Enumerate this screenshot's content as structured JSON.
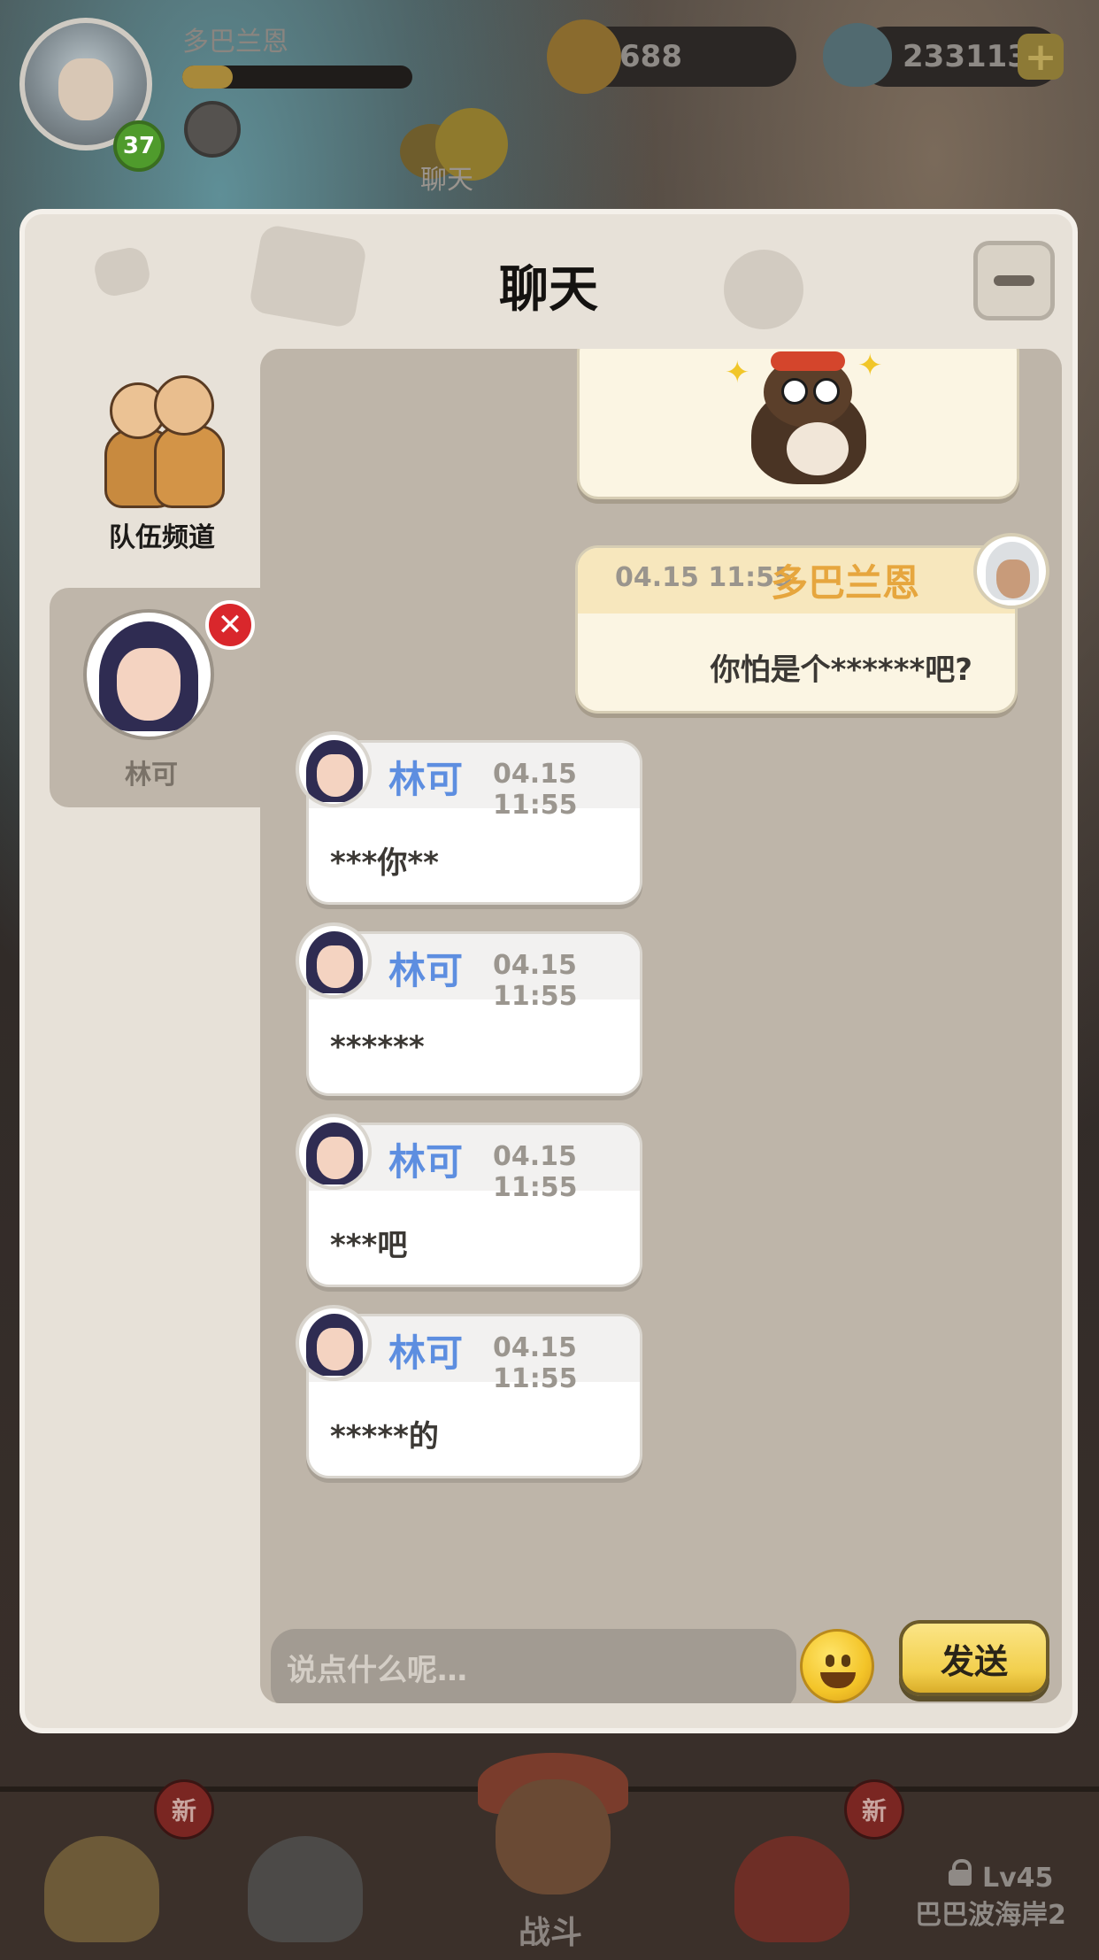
{
  "topbar": {
    "player_name": "多巴兰恩",
    "level": "37",
    "xp_progress": 0.22,
    "gold": "688",
    "gems": "233113",
    "plus_label": "+",
    "chat_label": "聊天"
  },
  "chat": {
    "title": "聊天",
    "channels": {
      "team_label": "队伍频道",
      "contact_name": "林可",
      "close_glyph": "✕"
    },
    "my_message": {
      "time": "04.15 11:55",
      "name": "多巴兰恩",
      "text": "你怕是个******吧?"
    },
    "incoming": [
      {
        "name": "林可",
        "time": "04.15 11:55",
        "text": "***你**"
      },
      {
        "name": "林可",
        "time": "04.15 11:55",
        "text": "******"
      },
      {
        "name": "林可",
        "time": "04.15 11:55",
        "text": "***吧"
      },
      {
        "name": "林可",
        "time": "04.15 11:55",
        "text": "*****的"
      }
    ],
    "input": {
      "placeholder": "说点什么呢…"
    },
    "send_label": "发送"
  },
  "bottom_nav": {
    "new_badge": "新",
    "battle_label": "战斗",
    "lock_level": "Lv45",
    "area_name": "巴巴波海岸2"
  },
  "colors": {
    "accent_gold": "#e6a63e",
    "incoming_name": "#5d8ee0",
    "close_red": "#d9272c",
    "send_yellow": "#f2cf4c"
  }
}
